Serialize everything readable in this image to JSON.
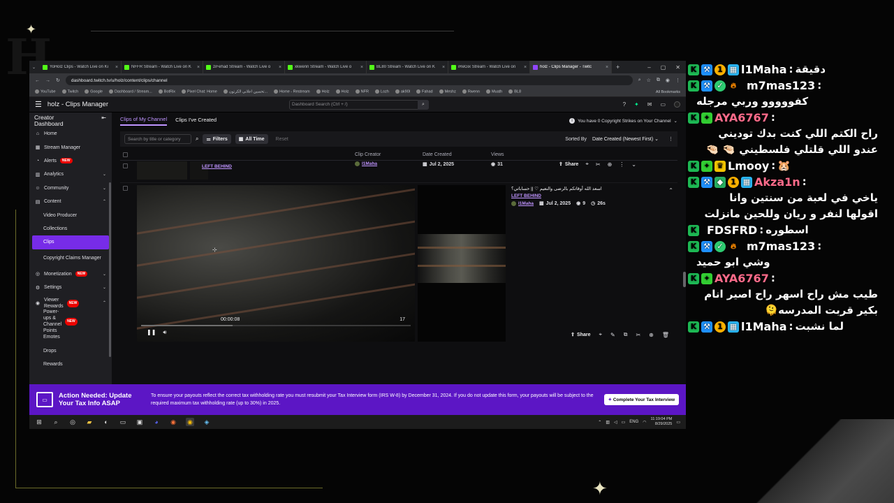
{
  "browser": {
    "tabs": [
      {
        "title": "YoHolz Clips - Watch Live on Ki"
      },
      {
        "title": "NFFR Stream - Watch Live on K"
      },
      {
        "title": "ziFehad Stream - Watch Live o"
      },
      {
        "title": "xkwenn Stream - Watch Live o"
      },
      {
        "title": "BL80 Stream - Watch Live on K"
      },
      {
        "title": "iReGix Stream - Watch Live on"
      },
      {
        "title": "holz - Clips Manager - Twitc"
      }
    ],
    "url": "dashboard.twitch.tv/u/holz/content/clips/channel",
    "bookmarks": [
      "YouTube",
      "Twitch",
      "Google",
      "Dashboard / Stream...",
      "BotRix",
      "Pixel Chat: Home",
      "تحسين اعلاني الكرتون...",
      "Home - Restream",
      "Holz",
      "Holz",
      "NFR",
      "Lozh",
      "ak90l",
      "Fahad",
      "Meshz",
      "Rwenn",
      "Muath",
      "BL8"
    ],
    "all_bookmarks": "All Bookmarks"
  },
  "twitch": {
    "title": "holz - Clips Manager",
    "search_placeholder": "Dashboard Search (Ctrl + /)",
    "sidebar": {
      "heading": "Creator Dashboard",
      "items": [
        {
          "label": "Home",
          "icon": "home-icon"
        },
        {
          "label": "Stream Manager",
          "icon": "stream-manager-icon"
        },
        {
          "label": "Alerts",
          "icon": "alerts-icon",
          "badge": "NEW"
        },
        {
          "label": "Analytics",
          "icon": "analytics-icon"
        },
        {
          "label": "Community",
          "icon": "community-icon"
        },
        {
          "label": "Content",
          "icon": "content-icon"
        },
        {
          "label": "Video Producer"
        },
        {
          "label": "Collections"
        },
        {
          "label": "Clips"
        },
        {
          "label": "Copyright Claims Manager"
        },
        {
          "label": "Monetization",
          "icon": "monetization-icon",
          "badge": "NEW"
        },
        {
          "label": "Settings",
          "icon": "settings-icon"
        },
        {
          "label": "Viewer Rewards",
          "icon": "rewards-icon",
          "badge": "NEW"
        },
        {
          "label": "Power-ups & Channel Points",
          "badge": "NEW"
        },
        {
          "label": "Emotes"
        },
        {
          "label": "Drops"
        },
        {
          "label": "Rewards"
        }
      ]
    },
    "tabs": {
      "mine": "Clips of My Channel",
      "created": "Clips I've Created"
    },
    "strikes": "You have 0 Copyright Strikes on Your Channel",
    "filters": {
      "search_placeholder": "Search by title or category",
      "filters_label": "Filters",
      "all_time": "All Time",
      "reset": "Reset",
      "sorted_by": "Sorted By",
      "sort_value": "Date Created (Newest First)"
    },
    "columns": {
      "creator": "Clip Creator",
      "date": "Date Created",
      "views": "Views"
    },
    "clip1": {
      "title": "LEFT BEHIND",
      "creator": "l1Maha",
      "date": "Jul 2, 2025",
      "views": "31",
      "share": "Share"
    },
    "clip2": {
      "title": "اسعد الله أوقاتكم بالرضى والنعيم ♡ || حساباتي؟",
      "category": "LEFT BEHIND",
      "creator": "l1Maha",
      "date": "Jul 2, 2025",
      "views": "9",
      "duration": "26s",
      "time": "00:00:08",
      "frame_num": "17",
      "share": "Share",
      "progress": 0.34
    },
    "banner": {
      "heading": "Action Needed: Update Your Tax Info ASAP",
      "text": "To ensure your payouts reflect the correct tax withholding rate you must resubmit your Tax Interview form (IRS W-8) by December 31, 2024. If you do not update this form, your payouts will be subject to the required maximum tax withholding rate (up to 30%) in 2025.",
      "button": "Complete Your Tax Interview"
    }
  },
  "taskbar": {
    "lang": "ENG",
    "time": "11:19:04 PM",
    "date": "8/29/2025"
  },
  "chat": [
    {
      "user": "l1Maha",
      "text": "دقيقة"
    },
    {
      "user": "m7mas123",
      "text": "كفووووو وربي مرجله"
    },
    {
      "user": "AYA6767",
      "text": "راح الكتم اللي كنت بدك توديني عندو اللي قلتلي فلسطيني 🤏🏻 🤏🏻"
    },
    {
      "user": "Lmooy",
      "text": "🐹"
    },
    {
      "user": "Akza1n",
      "text": "ياخي في لعبة من سنتين وانا اقولها لنفر و ريان وللحين مانزلت"
    },
    {
      "user": "FDSFRD",
      "text": "اسطوره"
    },
    {
      "user": "m7mas123",
      "text": "وشي ابو حميد"
    },
    {
      "user": "AYA6767",
      "text": "طيب مش راح اسهر راح اصير انام بكير قربت المدرسه🫠"
    },
    {
      "user": "l1Maha",
      "text": "لما نشبت"
    }
  ]
}
